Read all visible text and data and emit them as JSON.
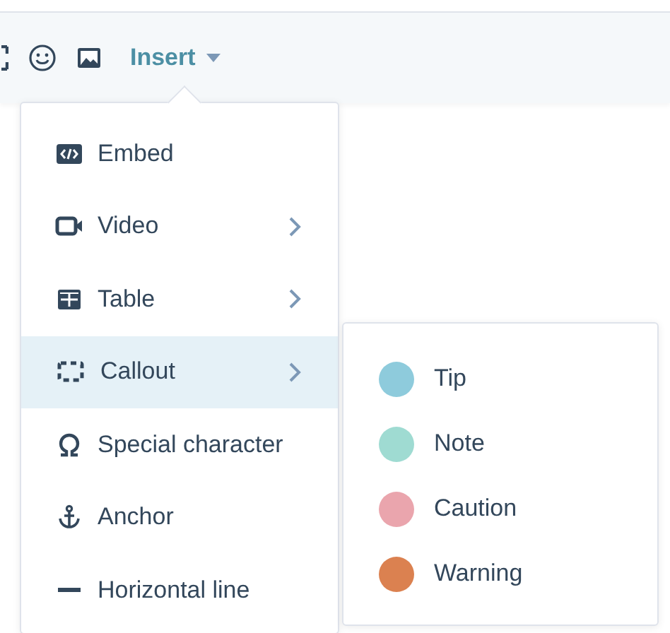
{
  "toolbar": {
    "insert_button": {
      "label": "Insert",
      "expanded": true
    }
  },
  "insert_menu": {
    "items": [
      {
        "label": "Embed",
        "has_submenu": false,
        "selected": false
      },
      {
        "label": "Video",
        "has_submenu": true,
        "selected": false
      },
      {
        "label": "Table",
        "has_submenu": true,
        "selected": false
      },
      {
        "label": "Callout",
        "has_submenu": true,
        "selected": true
      },
      {
        "label": "Special character",
        "has_submenu": false,
        "selected": false
      },
      {
        "label": "Anchor",
        "has_submenu": false,
        "selected": false
      },
      {
        "label": "Horizontal line",
        "has_submenu": false,
        "selected": false
      }
    ]
  },
  "callout_submenu": {
    "items": [
      {
        "label": "Tip",
        "color": "#8ecbdc"
      },
      {
        "label": "Note",
        "color": "#9fdbd2"
      },
      {
        "label": "Caution",
        "color": "#eaa5ad"
      },
      {
        "label": "Warning",
        "color": "#db8150"
      }
    ]
  }
}
